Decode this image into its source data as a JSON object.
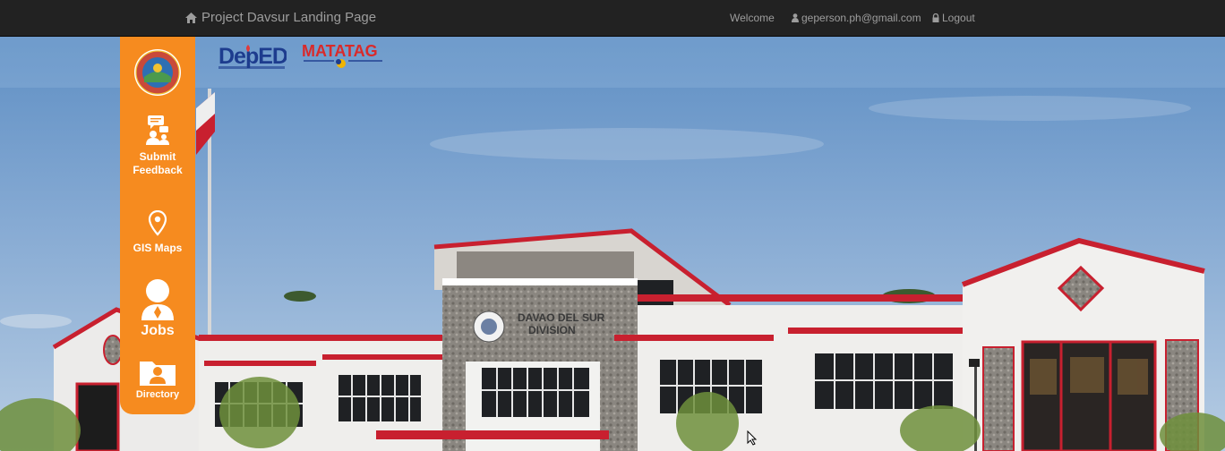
{
  "navbar": {
    "brand": "Project Davsur Landing Page",
    "welcome": "Welcome",
    "user_email": "geperson.ph@gmail.com",
    "logout": "Logout",
    "icons": {
      "brand": "home-icon",
      "user": "user-icon",
      "logout": "lock-icon"
    }
  },
  "logos": {
    "deped_text": "DepED",
    "matatag_text": "MATATAG"
  },
  "sidebar": {
    "color": "#f68b1f",
    "items": [
      {
        "label": "Submit Feedback",
        "icon": "feedback-icon"
      },
      {
        "label": "GIS Maps",
        "icon": "map-pin-icon"
      },
      {
        "label": "Jobs",
        "icon": "person-icon"
      },
      {
        "label": "Directory",
        "icon": "folder-person-icon"
      }
    ]
  },
  "hero": {
    "building_sign_line1": "DAVAO DEL SUR",
    "building_sign_line2": "DIVISION"
  },
  "colors": {
    "navbar_bg": "#222222",
    "navbar_text": "#9d9d9d",
    "accent_orange": "#f68b1f",
    "roof_red": "#c8202f"
  }
}
